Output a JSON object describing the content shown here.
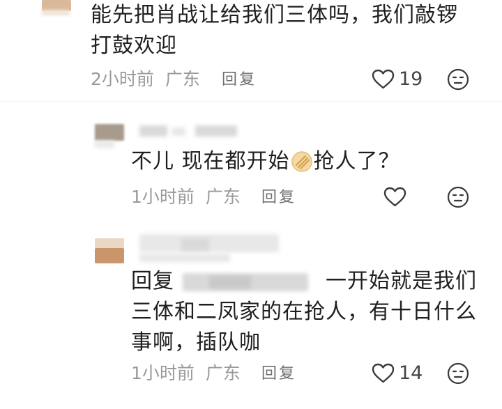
{
  "comments": [
    {
      "text_line1": "能先把肖战让给我们三体吗，我们敲锣",
      "text_line2": "打鼓欢迎",
      "time": "2小时前",
      "location": "广东",
      "reply_label": "回复",
      "likes": "19"
    },
    {
      "text_before_emoji": "不儿 现在都开始",
      "emoji_icon": "hand-fan-emoji",
      "text_after_emoji": "抢人了？",
      "time": "1小时前",
      "location": "广东",
      "reply_label": "回复",
      "likes": ""
    },
    {
      "reply_prefix": "回复",
      "text_line1_tail": "一开始就是我们",
      "text_line2": "三体和二凤家的在抢人，有十日什么",
      "text_line3": "事啊，插队咖",
      "time": "1小时前",
      "location": "广东",
      "reply_label": "回复",
      "likes": "14"
    }
  ],
  "colors": {
    "text": "#1f1f1f",
    "meta": "#9a9a9a",
    "icon": "#3a3a3a"
  }
}
